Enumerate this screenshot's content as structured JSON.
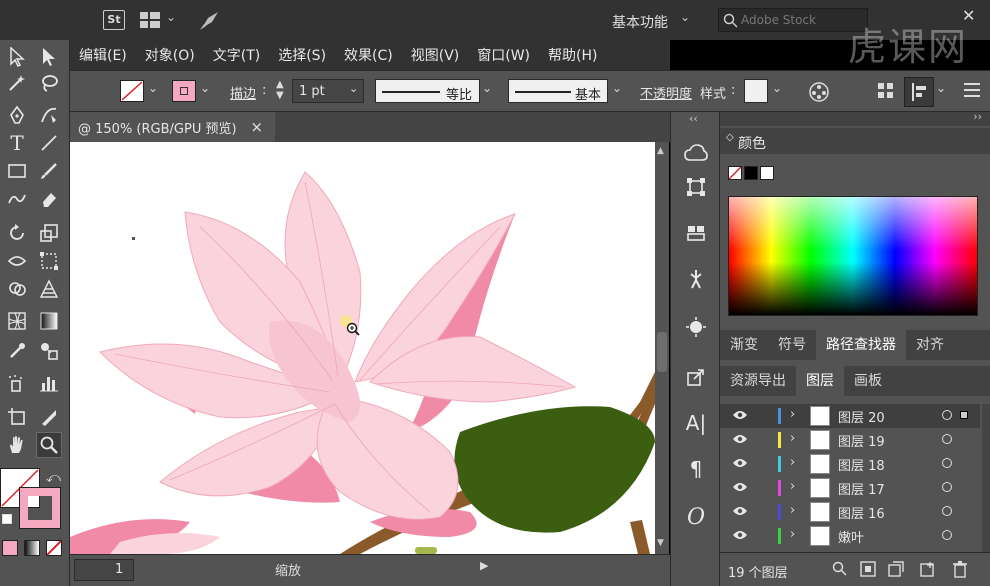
{
  "app": {
    "logo_label": "St",
    "workspace": "基本功能",
    "search_placeholder": "Adobe Stock",
    "watermark": "虎课网"
  },
  "menu": [
    {
      "label": "编辑(E)"
    },
    {
      "label": "对象(O)"
    },
    {
      "label": "文字(T)"
    },
    {
      "label": "选择(S)"
    },
    {
      "label": "效果(C)"
    },
    {
      "label": "视图(V)"
    },
    {
      "label": "窗口(W)"
    },
    {
      "label": "帮助(H)"
    }
  ],
  "options": {
    "stroke_label": "描边",
    "stroke_value": "1 pt",
    "profile_label": "等比",
    "brush_label": "基本",
    "opacity_label": "不透明度",
    "style_label": "样式",
    "fill_color": "#f5a9c0",
    "stroke_color": "#ffffff"
  },
  "document": {
    "tab_title": "@ 150% (RGB/GPU 预览)",
    "close_glyph": "×",
    "zoom_label": "缩放",
    "page_value": "1"
  },
  "color_panel": {
    "title": "颜色",
    "swatches": [
      "none",
      "#000000",
      "#ffffff"
    ]
  },
  "panel_tabs_top": [
    {
      "label": "渐变",
      "active": false
    },
    {
      "label": "符号",
      "active": false
    },
    {
      "label": "路径查找器",
      "active": true
    },
    {
      "label": "对齐",
      "active": false
    }
  ],
  "panel_tabs_layers": [
    {
      "label": "资源导出",
      "active": false
    },
    {
      "label": "图层",
      "active": true
    },
    {
      "label": "画板",
      "active": false
    }
  ],
  "layers": [
    {
      "name": "图层 20",
      "color": "#4a8fd8",
      "selected": true
    },
    {
      "name": "图层 19",
      "color": "#f2e84a",
      "selected": false
    },
    {
      "name": "图层 18",
      "color": "#3ad0e0",
      "selected": false
    },
    {
      "name": "图层 17",
      "color": "#e04ad8",
      "selected": false
    },
    {
      "name": "图层 16",
      "color": "#4a4ad8",
      "selected": false
    },
    {
      "name": "嫩叶",
      "color": "#3ad04a",
      "selected": false
    }
  ],
  "layers_footer": "19 个图层",
  "colors": {
    "petal_light": "#fbd3dc",
    "petal_mid": "#f7b9c8",
    "petal_dark": "#f08aa6",
    "leaf": "#3b5e10",
    "branch": "#8a5a2b"
  }
}
